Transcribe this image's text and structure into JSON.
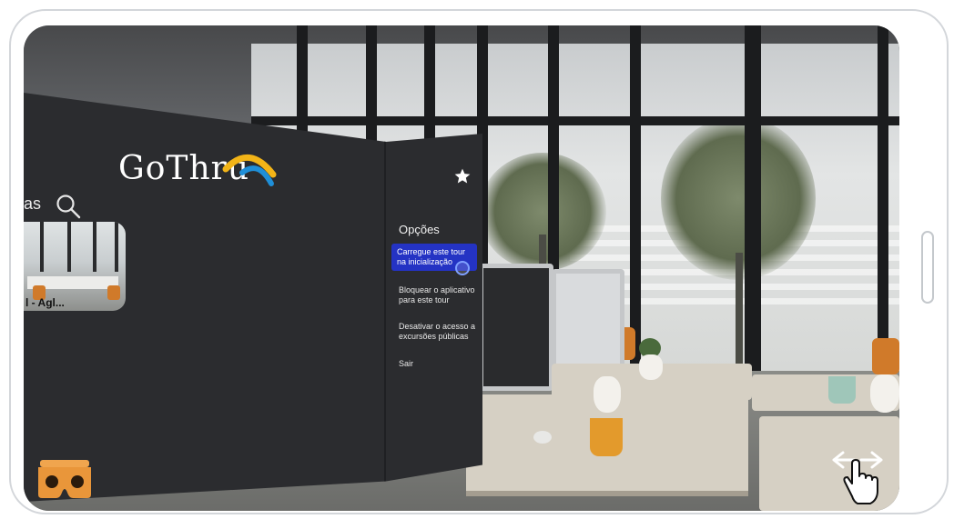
{
  "app": {
    "logo_text": "GoThru",
    "search_label_partial": "as",
    "thumbnail_caption": "l - Agl..."
  },
  "options_menu": {
    "title": "Opções",
    "items": [
      {
        "label": "Carregue este tour na inicialização",
        "selected": true
      },
      {
        "label": "Bloquear o aplicativo para este tour",
        "selected": false
      },
      {
        "label": "Desativar o acesso a excursões públicas",
        "selected": false
      },
      {
        "label": "Sair",
        "selected": false
      }
    ]
  },
  "icons": {
    "favorite": "star-icon",
    "search": "search-icon",
    "vr_mode": "cardboard-vr-icon",
    "pan": "drag-pan-hand-icon"
  },
  "colors": {
    "panel_bg": "#2b2c2f",
    "selected_item": "#2433c4",
    "logo_arc_yellow": "#f2b417",
    "logo_arc_blue": "#1f8fd8",
    "cardboard_orange": "#e9963a"
  }
}
